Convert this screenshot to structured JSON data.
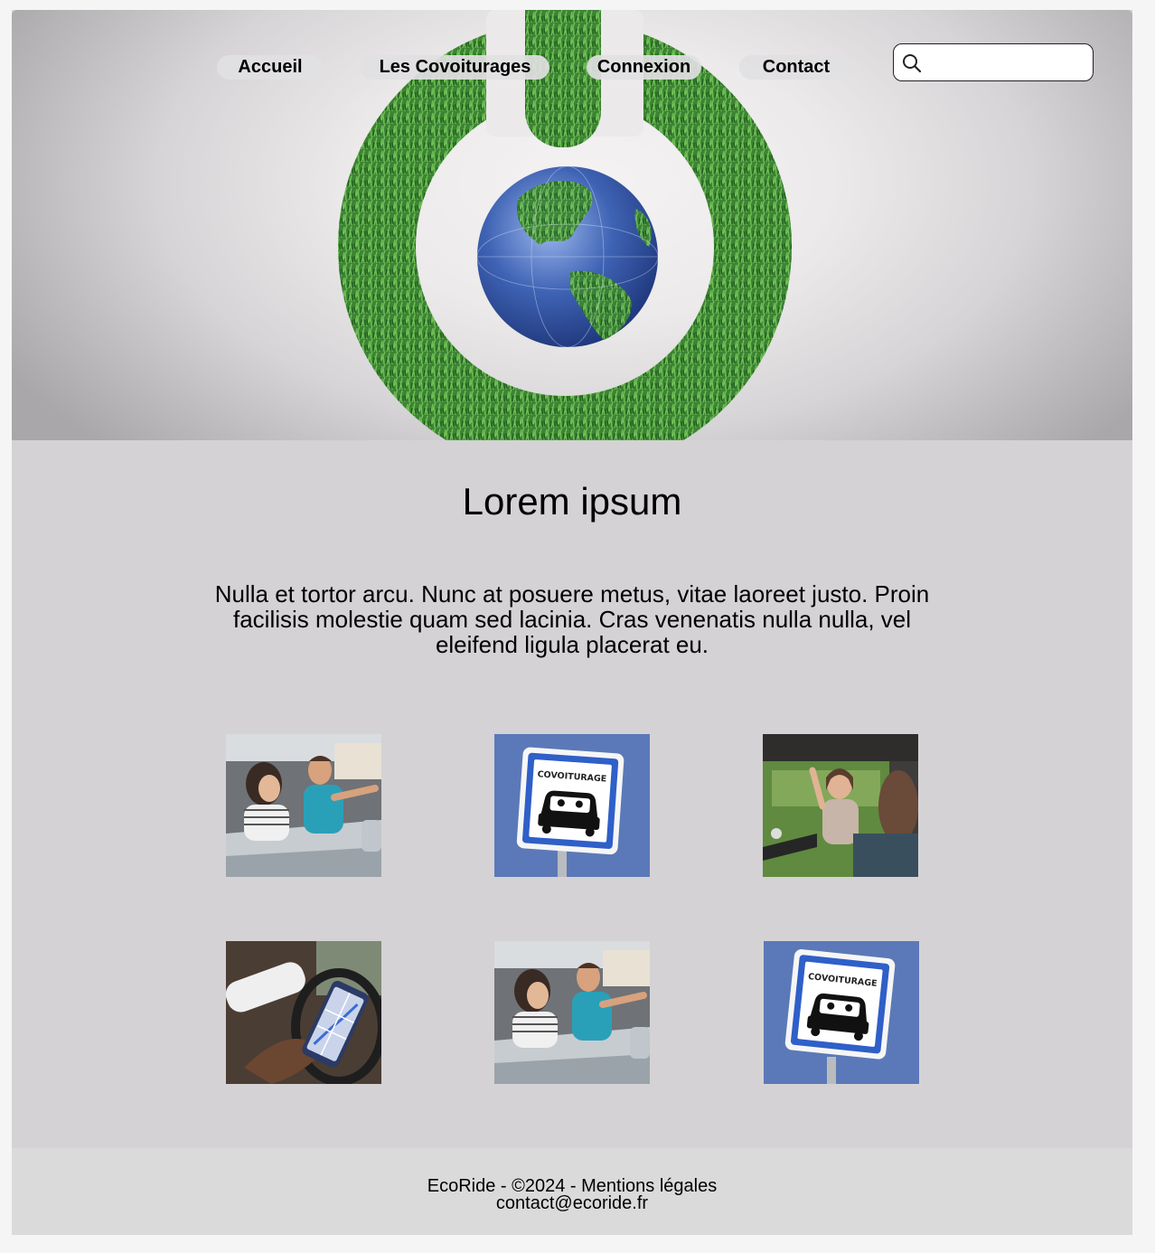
{
  "nav": {
    "items": [
      {
        "label": "Accueil"
      },
      {
        "label": "Les Covoiturages"
      },
      {
        "label": "Connexion"
      },
      {
        "label": "Contact"
      }
    ],
    "search_placeholder": ""
  },
  "main": {
    "title": "Lorem ipsum",
    "intro": "Nulla et tortor arcu. Nunc at posuere metus, vitae laoreet justo. Proin facilisis molestie quam sed lacinia. Cras venenatis nulla nulla, vel eleifend ligula placerat eu."
  },
  "sign_text": "COVOITURAGE",
  "footer": {
    "line1": "EcoRide - ©2024 - Mentions légales",
    "line2": "contact@ecoride.fr"
  },
  "colors": {
    "grass": "#3f8a36",
    "globe": "#3f63b4",
    "sign_blue": "#2f5fc8",
    "content_bg": "#d4d2d4",
    "footer_bg": "#dadada"
  }
}
